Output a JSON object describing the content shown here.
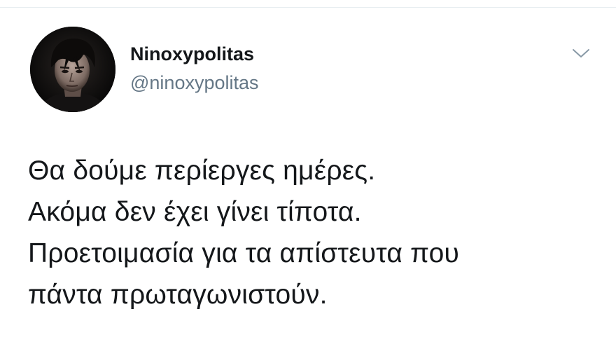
{
  "tweet": {
    "author": {
      "display_name": "Ninoxypolitas",
      "handle": "@ninoxypolitas",
      "avatar": "avatar-photo"
    },
    "menu_icon": "chevron-down-icon",
    "text_lines": [
      "Θα δούμε περίεργες ημέρες.",
      "Ακόμα δεν έχει γίνει τίποτα.",
      "Προετοιμασία για τα απίστευτα που",
      "πάντα πρωταγωνιστούν."
    ]
  },
  "colors": {
    "text": "#14171a",
    "secondary_text": "#657786",
    "divider": "#e6ecf0",
    "caret": "#8899a6"
  }
}
